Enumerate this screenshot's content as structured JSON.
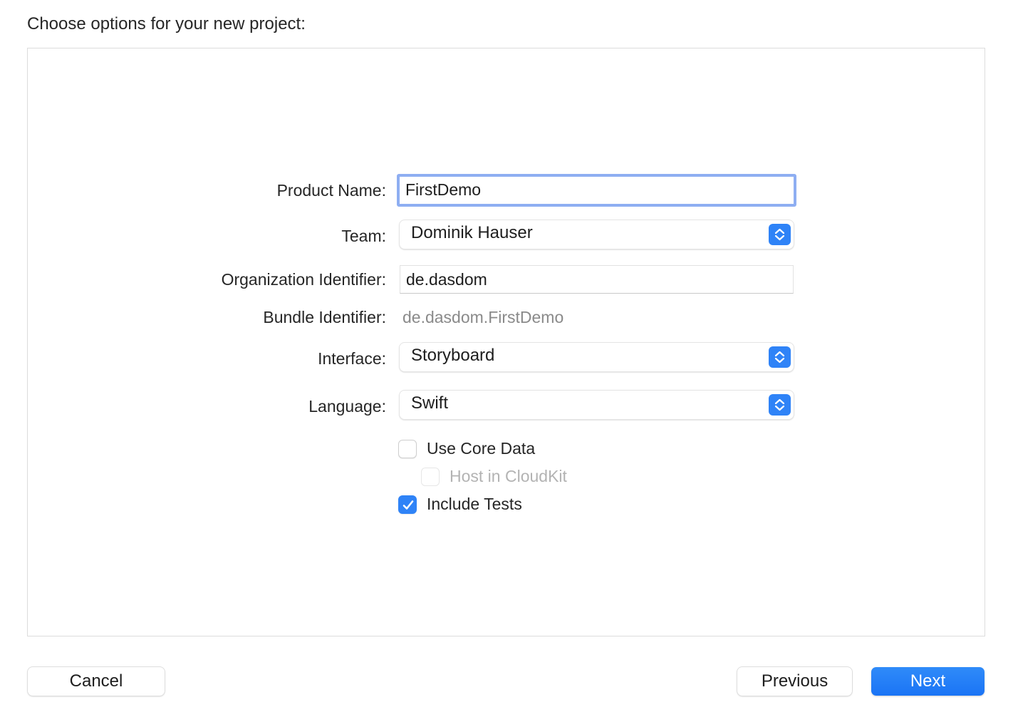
{
  "dialog": {
    "title": "Choose options for your new project:"
  },
  "form": {
    "product_name": {
      "label": "Product Name:",
      "value": "FirstDemo"
    },
    "team": {
      "label": "Team:",
      "value": "Dominik Hauser"
    },
    "organization_identifier": {
      "label": "Organization Identifier:",
      "value": "de.dasdom"
    },
    "bundle_identifier": {
      "label": "Bundle Identifier:",
      "value": "de.dasdom.FirstDemo"
    },
    "interface": {
      "label": "Interface:",
      "value": "Storyboard"
    },
    "language": {
      "label": "Language:",
      "value": "Swift"
    },
    "checkboxes": [
      {
        "label": "Use Core Data",
        "checked": false,
        "enabled": true
      },
      {
        "label": "Host in CloudKit",
        "checked": false,
        "enabled": false
      },
      {
        "label": "Include Tests",
        "checked": true,
        "enabled": true
      }
    ]
  },
  "buttons": {
    "cancel": "Cancel",
    "previous": "Previous",
    "next": "Next"
  },
  "colors": {
    "accent": "#2f83f7",
    "focus_ring": "#8eaef2"
  }
}
